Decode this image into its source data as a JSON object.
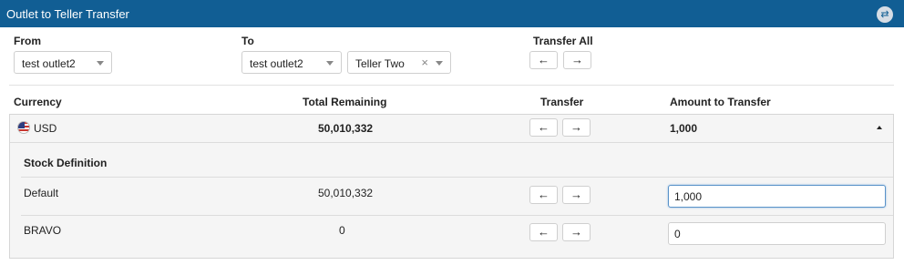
{
  "header": {
    "title": "Outlet to Teller Transfer",
    "action_icon": "swap-icon",
    "accent": "#115e94"
  },
  "from": {
    "label": "From",
    "outlet": "test outlet2"
  },
  "to": {
    "label": "To",
    "outlet": "test outlet2",
    "teller": "Teller Two"
  },
  "transfer_all": {
    "label": "Transfer All",
    "left": "←",
    "right": "→"
  },
  "columns": {
    "currency": "Currency",
    "total_remaining": "Total Remaining",
    "transfer": "Transfer",
    "amount": "Amount to Transfer"
  },
  "currency_row": {
    "flag": "us-flag-icon",
    "code": "USD",
    "total": "50,010,332",
    "amount": "1,000",
    "left": "←",
    "right": "→"
  },
  "stock": {
    "heading": "Stock Definition",
    "rows": [
      {
        "name": "Default",
        "total": "50,010,332",
        "amount": "1,000",
        "left": "←",
        "right": "→"
      },
      {
        "name": "BRAVO",
        "total": "0",
        "amount": "0",
        "left": "←",
        "right": "→"
      }
    ]
  }
}
